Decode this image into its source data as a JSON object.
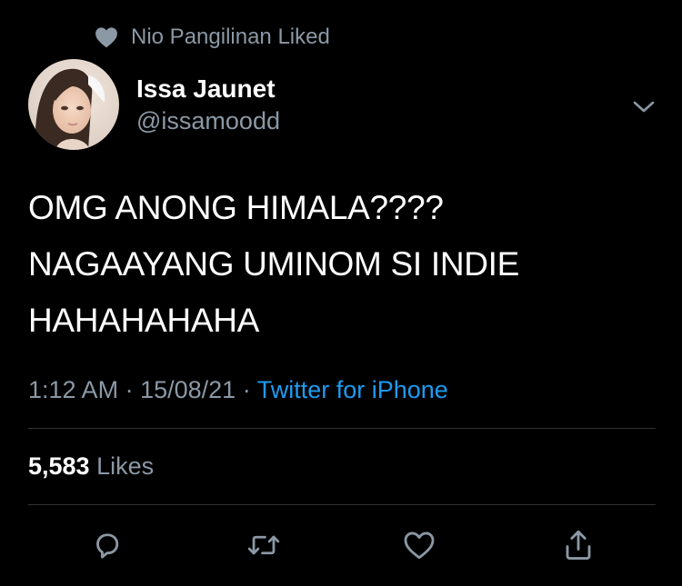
{
  "social_context": {
    "icon": "heart-icon",
    "text": "Nio Pangilinan Liked"
  },
  "author": {
    "display_name": "Issa Jaunet",
    "handle": "@issamoodd"
  },
  "tweet": {
    "lines": [
      "OMG ANONG HIMALA????",
      "NAGAAYANG UMINOM SI INDIE",
      "HAHAHAHAHA"
    ],
    "time": "1:12 AM",
    "separator": "·",
    "date": "15/08/21",
    "source": "Twitter for iPhone"
  },
  "stats": {
    "likes_count": "5,583",
    "likes_label": "Likes"
  },
  "actions": [
    {
      "name": "reply",
      "icon": "reply-icon"
    },
    {
      "name": "retweet",
      "icon": "retweet-icon"
    },
    {
      "name": "like",
      "icon": "heart-outline-icon"
    },
    {
      "name": "share",
      "icon": "share-icon"
    }
  ],
  "colors": {
    "background": "#000000",
    "primary_text": "#ffffff",
    "secondary_text": "#8b98a5",
    "link": "#1d9bf0",
    "divider": "#2f3336"
  }
}
